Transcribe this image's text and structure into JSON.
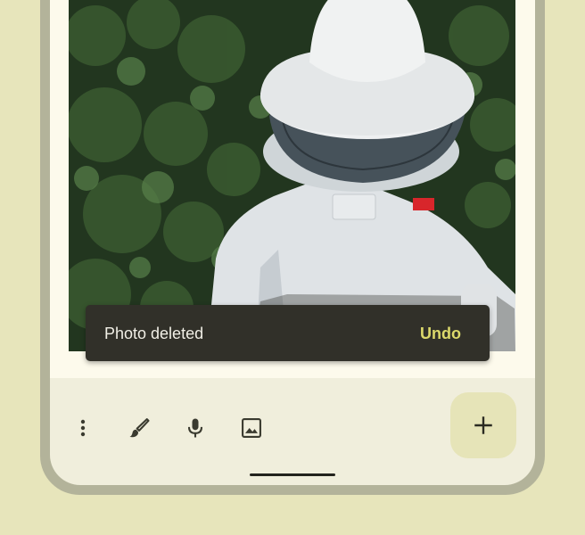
{
  "snackbar": {
    "message": "Photo deleted",
    "action_label": "Undo"
  },
  "toolbar": {
    "icons": [
      "more-vert-icon",
      "brush-icon",
      "mic-icon",
      "image-icon"
    ],
    "fab_icon": "add-icon"
  },
  "photo": {
    "subject": "beekeeper-photo"
  },
  "colors": {
    "background": "#e7e5bb",
    "frame": "#b3b39a",
    "screen": "#f0eedc",
    "snackbar": "#313029",
    "snackbar_action": "#dcd96b",
    "fab": "#e6e4b8"
  }
}
